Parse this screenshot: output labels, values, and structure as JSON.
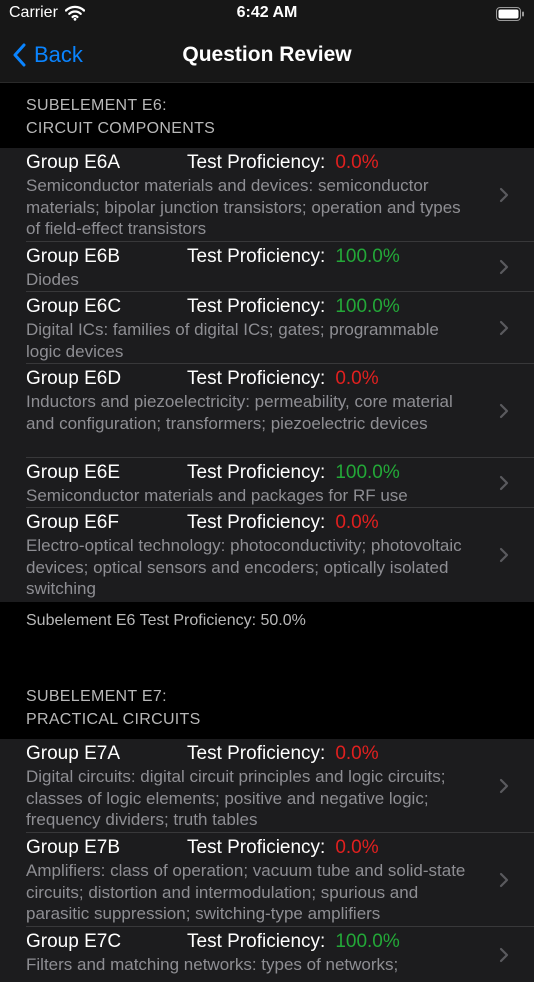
{
  "status_bar": {
    "carrier": "Carrier",
    "time": "6:42 AM"
  },
  "nav": {
    "back_label": "Back",
    "title": "Question Review"
  },
  "colors": {
    "accent": "#0a84ff",
    "fail": "#e0201f",
    "pass": "#23a838"
  },
  "sections": [
    {
      "header_line1": "SUBELEMENT E6:",
      "header_line2": "CIRCUIT COMPONENTS",
      "rows": [
        {
          "group": "Group E6A",
          "prof_label": "Test Proficiency:",
          "prof_value": "0.0%",
          "status": "fail",
          "desc": "Semiconductor materials and devices: semiconductor materials; bipolar junction transistors; operation and types of field-effect transistors"
        },
        {
          "group": "Group E6B",
          "prof_label": "Test Proficiency:",
          "prof_value": "100.0%",
          "status": "pass",
          "desc": "Diodes"
        },
        {
          "group": "Group E6C",
          "prof_label": "Test Proficiency:",
          "prof_value": "100.0%",
          "status": "pass",
          "desc": "Digital ICs: families of digital ICs; gates; programmable logic devices"
        },
        {
          "group": "Group E6D",
          "prof_label": "Test Proficiency:",
          "prof_value": "0.0%",
          "status": "fail",
          "desc": "Inductors and piezoelectricity: permeability, core material and configuration; transformers; piezoelectric devices"
        },
        {
          "group": "Group E6E",
          "prof_label": "Test Proficiency:",
          "prof_value": "100.0%",
          "status": "pass",
          "desc": "Semiconductor materials and packages for RF use"
        },
        {
          "group": "Group E6F",
          "prof_label": "Test Proficiency:",
          "prof_value": "0.0%",
          "status": "fail",
          "desc": "Electro-optical technology: photoconductivity; photovoltaic devices; optical sensors and encoders; optically isolated switching"
        }
      ],
      "footer": "Subelement E6 Test Proficiency:  50.0%"
    },
    {
      "header_line1": "SUBELEMENT E7:",
      "header_line2": "PRACTICAL CIRCUITS",
      "rows": [
        {
          "group": "Group E7A",
          "prof_label": "Test Proficiency:",
          "prof_value": "0.0%",
          "status": "fail",
          "desc": "Digital circuits: digital circuit principles and logic circuits; classes of logic elements; positive and negative logic; frequency dividers; truth tables"
        },
        {
          "group": "Group E7B",
          "prof_label": "Test Proficiency:",
          "prof_value": "0.0%",
          "status": "fail",
          "desc": "Amplifiers: class of operation; vacuum tube and solid-state circuits; distortion and intermodulation; spurious and parasitic suppression; switching-type amplifiers"
        },
        {
          "group": "Group E7C",
          "prof_label": "Test Proficiency:",
          "prof_value": "100.0%",
          "status": "pass",
          "desc": "Filters and matching networks: types of networks;"
        }
      ]
    }
  ]
}
